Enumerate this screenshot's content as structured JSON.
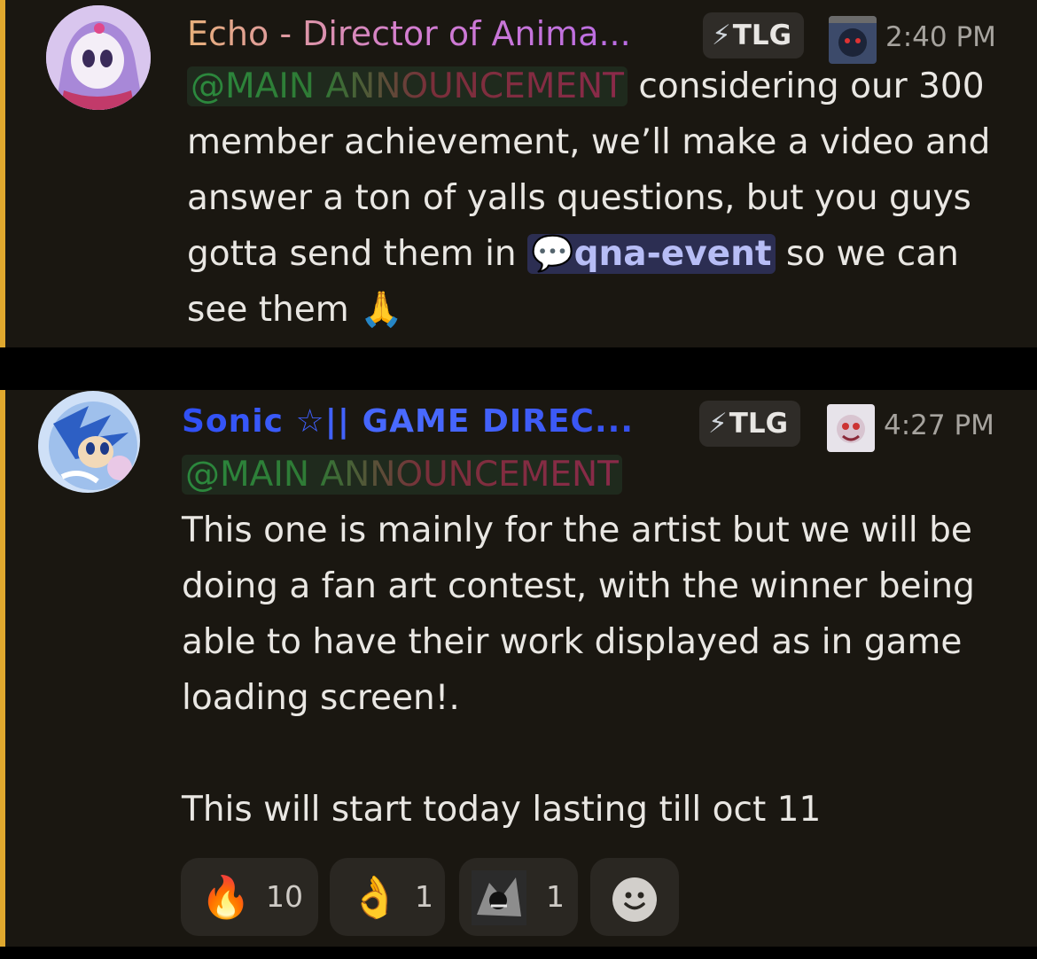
{
  "messages": [
    {
      "username": "Echo - Director of Anima...",
      "tag": "TLG",
      "time": "2:40 PM",
      "mention": "@MAIN ANNOUNCEMENT",
      "text_before_channel": "considering our 300 member achievement, we’ll make a video and answer a ton of yalls questions, but you guys gotta send them in",
      "channel_name": "qna-event",
      "text_after_channel": "so we can see them",
      "emoji": "🙏"
    },
    {
      "username": "Sonic ☆|| GAME DIREC...",
      "tag": "TLG",
      "time": "4:27 PM",
      "mention": "@MAIN ANNOUNCEMENT",
      "paragraph1": "This one is mainly for the artist but we will be doing a fan art contest, with the winner being able to have their work displayed as in game loading screen!.",
      "paragraph2": "This will start today lasting till oct 11",
      "reactions": [
        {
          "emoji": "🔥",
          "count": "10"
        },
        {
          "emoji": "👌",
          "count": "1"
        },
        {
          "emoji": "custom-emoji",
          "count": "1"
        },
        {
          "emoji": "add-reaction-icon",
          "count": ""
        }
      ]
    }
  ],
  "colors": {
    "background": "#1a1711",
    "accent_bar": "#e0a82e",
    "channel_pill": "#2c2e52",
    "username_sonic": "#3b57f5"
  }
}
